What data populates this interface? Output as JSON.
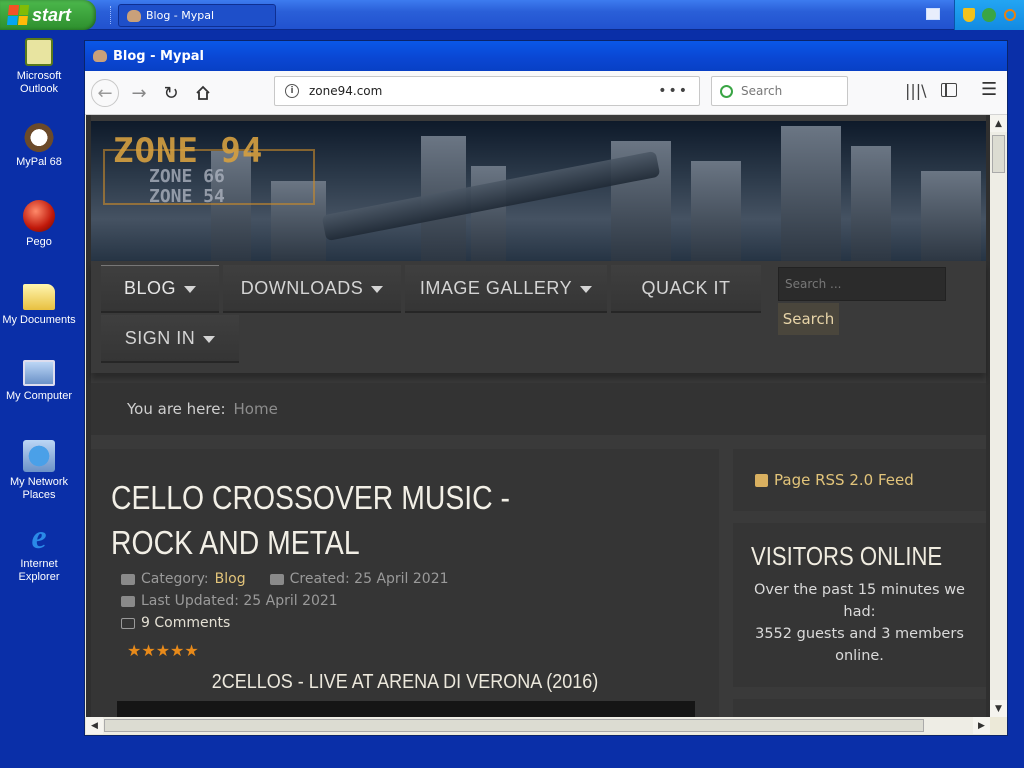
{
  "taskbar": {
    "start_label": "start",
    "task_label": "Blog - Mypal"
  },
  "desktop": {
    "icons": [
      {
        "label": "Microsoft Outlook",
        "icon": "outlook-icon"
      },
      {
        "label": "MyPal 68",
        "icon": "mypal-icon"
      },
      {
        "label": "Pego",
        "icon": "pego-icon"
      },
      {
        "label": "My Documents",
        "icon": "folder-icon"
      },
      {
        "label": "My Computer",
        "icon": "computer-icon"
      },
      {
        "label": "My Network Places",
        "icon": "network-icon"
      },
      {
        "label": "Internet Explorer",
        "icon": "ie-icon"
      }
    ]
  },
  "window": {
    "title": "Blog - Mypal"
  },
  "browser": {
    "url": "zone94.com",
    "search_placeholder": "Search",
    "page_actions": "•••"
  },
  "site": {
    "logo_main": "ZONE 94",
    "logo_sub1": "ZONE 66",
    "logo_sub2": "ZONE 54",
    "nav": {
      "blog": "BLOG",
      "downloads": "DOWNLOADS",
      "gallery": "IMAGE GALLERY",
      "quack": "QUACK IT",
      "signin": "SIGN IN"
    },
    "search_placeholder": "Search ...",
    "search_button": "Search",
    "breadcrumb_label": "You are here:",
    "breadcrumb_home": "Home",
    "article": {
      "title": "CELLO CROSSOVER MUSIC - ROCK AND METAL",
      "category_label": "Category:",
      "category": "Blog",
      "created": "Created: 25 April 2021",
      "updated": "Last Updated: 25 April 2021",
      "comments": "9 Comments",
      "rating_stars": 5,
      "video_title": "2CELLOS - LIVE AT ARENA DI VERONA (2016)"
    },
    "rss": "Page RSS 2.0 Feed",
    "visitors": {
      "title": "VISITORS ONLINE",
      "line1": "Over the past 15 minutes we had:",
      "line2": "3552 guests and 3 members online."
    }
  },
  "colors": {
    "desktop_bg": "#0a2fa8",
    "titlebar": "#0a4ad6",
    "site_link": "#e2c47a",
    "star": "#e88a1a"
  }
}
